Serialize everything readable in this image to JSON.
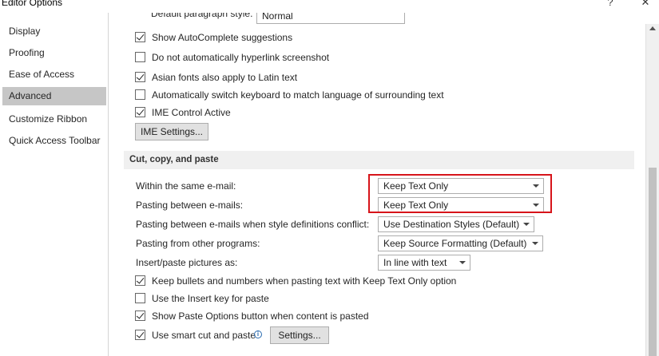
{
  "window": {
    "title": "Editor Options",
    "help_glyph": "?",
    "close_glyph": "✕"
  },
  "sidebar": {
    "items": [
      {
        "label": "Display"
      },
      {
        "label": "Proofing"
      },
      {
        "label": "Ease of Access"
      },
      {
        "label": "Advanced",
        "active": true
      },
      {
        "label": "Customize Ribbon"
      },
      {
        "label": "Quick Access Toolbar"
      }
    ]
  },
  "top_options": {
    "default_paragraph_style_label": "Default paragraph style:",
    "default_paragraph_style_value": "Normal",
    "checkboxes": [
      {
        "label": "Show AutoComplete suggestions",
        "checked": true
      },
      {
        "label": "Do not automatically hyperlink screenshot",
        "checked": false
      },
      {
        "label": "Asian fonts also apply to Latin text",
        "checked": true
      },
      {
        "label": "Automatically switch keyboard to match language of surrounding text",
        "checked": false
      },
      {
        "label": "IME Control Active",
        "checked": true
      }
    ],
    "ime_settings_button": "IME Settings..."
  },
  "cut_copy_paste": {
    "heading": "Cut, copy, and paste",
    "dropdowns": [
      {
        "label": "Within the same e-mail:",
        "value": "Keep Text Only"
      },
      {
        "label": "Pasting between e-mails:",
        "value": "Keep Text Only"
      },
      {
        "label": "Pasting between e-mails when style definitions conflict:",
        "value": "Use Destination Styles (Default)"
      },
      {
        "label": "Pasting from other programs:",
        "value": "Keep Source Formatting (Default)"
      },
      {
        "label": "Insert/paste pictures as:",
        "value": "In line with text"
      }
    ],
    "checkboxes": [
      {
        "label": "Keep bullets and numbers when pasting text with Keep Text Only option",
        "checked": true
      },
      {
        "label": "Use the Insert key for paste",
        "checked": false
      },
      {
        "label": "Show Paste Options button when content is pasted",
        "checked": true
      },
      {
        "label": "Use smart cut and paste",
        "checked": true
      }
    ],
    "settings_button": "Settings...",
    "info_glyph": "i"
  },
  "colors": {
    "highlight_border": "#d7141a",
    "selected_nav": "#c6c6c6",
    "section_bg": "#f0f0f0"
  }
}
